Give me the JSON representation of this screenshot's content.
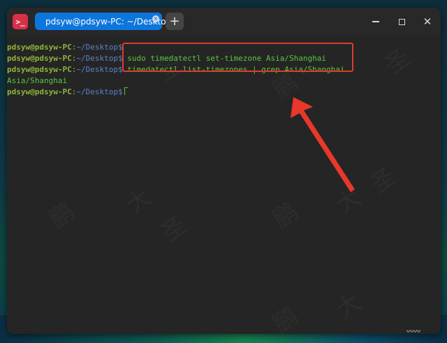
{
  "window": {
    "tab_title": "pdsyw@pdsyw-PC: ~/Desktop",
    "tab_close_symbol": "×",
    "new_tab_symbol": "+",
    "close_symbol": "✕"
  },
  "terminal": {
    "prompt_user": "pdsyw@pdsyw-PC",
    "prompt_sep": ":",
    "prompt_path": "~/Desktop",
    "prompt_dollar": "$",
    "lines": [
      {
        "cmd": ""
      },
      {
        "cmd": " sudo timedatectl set-timezone Asia/Shanghai"
      },
      {
        "cmd": " timedatectl list-timezones | grep Asia/Shanghai"
      }
    ],
    "output": "Asia/Shanghai"
  },
  "watermark": {
    "chars": [
      "鹏",
      "大",
      "圣"
    ]
  },
  "colors": {
    "highlight": "#e03a2a",
    "tab_accent": "#0d76dd",
    "prompt_user": "#8fb539",
    "prompt_path": "#5b82c7",
    "command_text": "#55c93c"
  },
  "icons": {
    "app": "terminal-icon",
    "annotation": "red-arrow-icon"
  }
}
